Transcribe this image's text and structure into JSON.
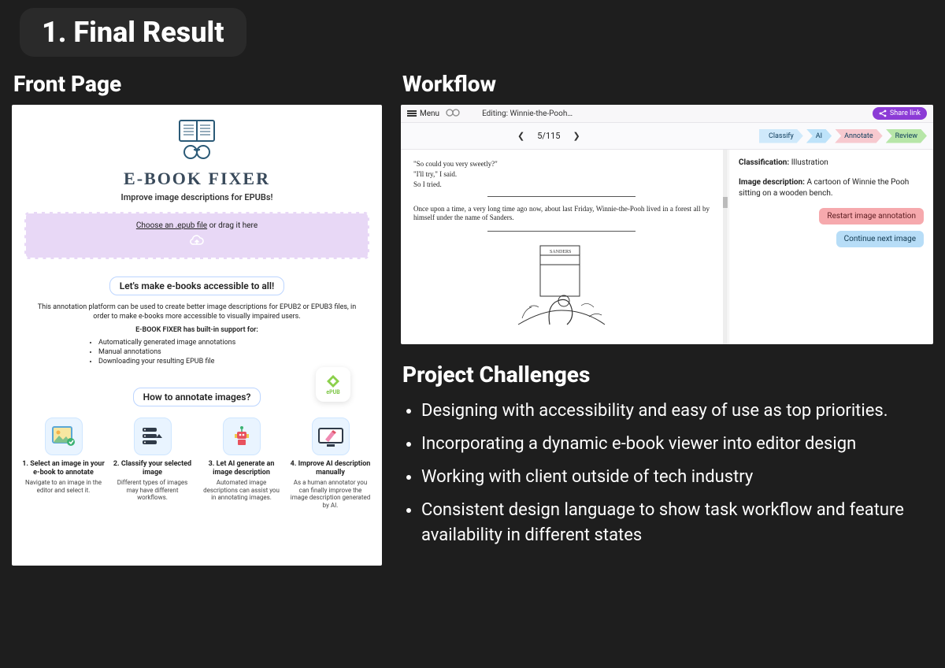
{
  "slide": {
    "title": "1. Final Result",
    "left_heading": "Front Page",
    "right_heading": "Workflow",
    "challenges_heading": "Project Challenges"
  },
  "frontpage": {
    "app_title": "E-BOOK FIXER",
    "subtitle": "Improve image descriptions for EPUBs!",
    "upload_prefix": "Choose an .epub file",
    "upload_suffix": " or drag it here",
    "callout1": "Let's make e-books accessible to all!",
    "intro_para": "This annotation platform can be used to create better image descriptions for EPUB2 or EPUB3 files, in order to make e-books more accessible to visually impaired users.",
    "builtin_line": "E-BOOK FIXER has built-in support for:",
    "features": {
      "0": "Automatically generated image annotations",
      "1": "Manual annotations",
      "2": "Downloading your resulting EPUB file"
    },
    "epub_badge": "ePUB",
    "callout2": "How to annotate images?",
    "steps": {
      "0": {
        "title": "1. Select an image in your e-book to annotate",
        "desc": "Navigate to an image in the editor and select it."
      },
      "1": {
        "title": "2. Classify your selected image",
        "desc": "Different types of images may have different workflows."
      },
      "2": {
        "title": "3. Let AI generate an image description",
        "desc": "Automated image descriptions can assist you in annotating images."
      },
      "3": {
        "title": "4. Improve AI description manually",
        "desc": "As a human annotator you can finally improve the image description generated by AI."
      }
    }
  },
  "workflow": {
    "menu_label": "Menu",
    "editing_label": "Editing: Winnie-the-Pooh…",
    "share_label": "Share link",
    "page_counter": "5/115",
    "chips": {
      "classify": "Classify",
      "ai": "AI",
      "annotate": "Annotate",
      "review": "Review"
    },
    "book_lines": {
      "0": "\"So could you very sweetly?\"",
      "1": "\"I'll try,\" I said.",
      "2": "So I tried."
    },
    "book_para": "Once upon a time, a very long time ago now, about last Friday, Winnie-the-Pooh lived in a forest all by himself under the name of Sanders.",
    "classification_label": "Classification:",
    "classification_value": "Illustration",
    "imgdesc_label": "Image description:",
    "imgdesc_value": "A cartoon of Winnie the Pooh sitting on a wooden bench.",
    "btn_restart": "Restart image annotation",
    "btn_continue": "Continue next image"
  },
  "challenges": {
    "0": "Designing with accessibility and easy of use as top priorities.",
    "1": "Incorporating a dynamic e-book viewer into editor design",
    "2": "Working with client outside of tech industry",
    "3": "Consistent design language to show task workflow and feature availability in different states"
  }
}
